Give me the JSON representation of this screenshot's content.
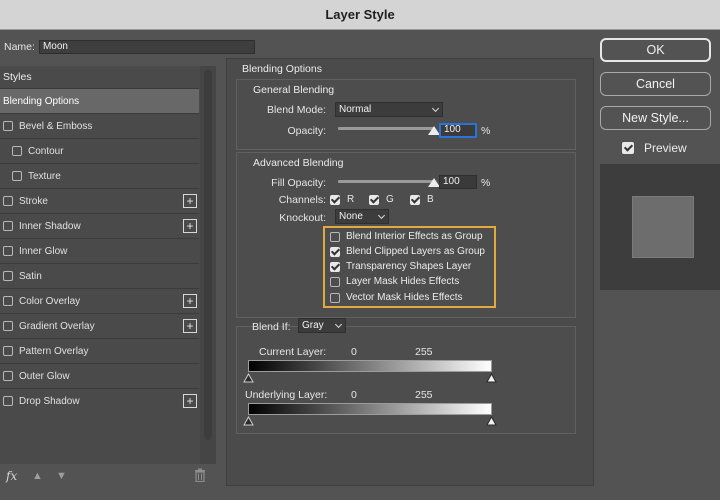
{
  "window": {
    "title": "Layer Style"
  },
  "name_field": {
    "label": "Name:",
    "value": "Moon"
  },
  "styles_panel": {
    "header": "Styles",
    "items": [
      {
        "label": "Blending Options",
        "checkbox": false,
        "checked": false,
        "plus": false,
        "selected": true,
        "sub": false
      },
      {
        "label": "Bevel & Emboss",
        "checkbox": true,
        "checked": false,
        "plus": false,
        "selected": false,
        "sub": false
      },
      {
        "label": "Contour",
        "checkbox": true,
        "checked": false,
        "plus": false,
        "selected": false,
        "sub": true
      },
      {
        "label": "Texture",
        "checkbox": true,
        "checked": false,
        "plus": false,
        "selected": false,
        "sub": true
      },
      {
        "label": "Stroke",
        "checkbox": true,
        "checked": false,
        "plus": true,
        "selected": false,
        "sub": false
      },
      {
        "label": "Inner Shadow",
        "checkbox": true,
        "checked": false,
        "plus": true,
        "selected": false,
        "sub": false
      },
      {
        "label": "Inner Glow",
        "checkbox": true,
        "checked": false,
        "plus": false,
        "selected": false,
        "sub": false
      },
      {
        "label": "Satin",
        "checkbox": true,
        "checked": false,
        "plus": false,
        "selected": false,
        "sub": false
      },
      {
        "label": "Color Overlay",
        "checkbox": true,
        "checked": false,
        "plus": true,
        "selected": false,
        "sub": false
      },
      {
        "label": "Gradient Overlay",
        "checkbox": true,
        "checked": false,
        "plus": true,
        "selected": false,
        "sub": false
      },
      {
        "label": "Pattern Overlay",
        "checkbox": true,
        "checked": false,
        "plus": false,
        "selected": false,
        "sub": false
      },
      {
        "label": "Outer Glow",
        "checkbox": true,
        "checked": false,
        "plus": false,
        "selected": false,
        "sub": false
      },
      {
        "label": "Drop Shadow",
        "checkbox": true,
        "checked": false,
        "plus": true,
        "selected": false,
        "sub": false
      }
    ],
    "plus_symbol": "+",
    "bottom": {
      "fx": "fx",
      "up_arrow": "▲",
      "down_arrow": "▼",
      "icons": [
        "fx-icon",
        "arrow-up-icon",
        "arrow-down-icon",
        "trash-icon"
      ]
    }
  },
  "blending_options": {
    "title": "Blending Options",
    "general": {
      "title": "General Blending",
      "blend_mode_label": "Blend Mode:",
      "blend_mode_value": "Normal",
      "opacity_label": "Opacity:",
      "opacity_value": "100",
      "opacity_percent": 100,
      "unit": "%"
    },
    "advanced": {
      "title": "Advanced Blending",
      "fill_opacity_label": "Fill Opacity:",
      "fill_opacity_value": "100",
      "fill_opacity_percent": 100,
      "unit": "%",
      "channels_label": "Channels:",
      "channels": [
        {
          "label": "R",
          "checked": true
        },
        {
          "label": "G",
          "checked": true
        },
        {
          "label": "B",
          "checked": true
        }
      ],
      "knockout_label": "Knockout:",
      "knockout_value": "None",
      "options": [
        {
          "label": "Blend Interior Effects as Group",
          "checked": false
        },
        {
          "label": "Blend Clipped Layers as Group",
          "checked": true
        },
        {
          "label": "Transparency Shapes Layer",
          "checked": true
        },
        {
          "label": "Layer Mask Hides Effects",
          "checked": false
        },
        {
          "label": "Vector Mask Hides Effects",
          "checked": false
        }
      ],
      "highlight_color": "#e2a941"
    },
    "blend_if": {
      "label": "Blend If:",
      "value": "Gray",
      "current_layer": {
        "label": "Current Layer:",
        "min": "0",
        "max": "255"
      },
      "underlying_layer": {
        "label": "Underlying Layer:",
        "min": "0",
        "max": "255"
      }
    }
  },
  "buttons": {
    "ok": "OK",
    "cancel": "Cancel",
    "new_style": "New Style..."
  },
  "preview": {
    "label": "Preview",
    "checked": true
  },
  "colors": {
    "background": "#535353",
    "focus": "#2b72d9",
    "titlebar": "#d4d4d4"
  }
}
